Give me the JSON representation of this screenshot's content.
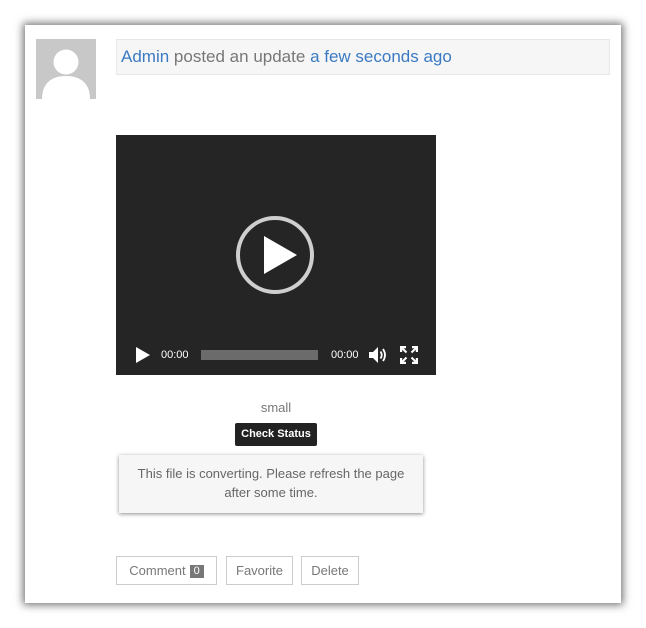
{
  "activity": {
    "user_name": "Admin",
    "action_text": "posted an update",
    "time_text": "a few seconds ago"
  },
  "video": {
    "current_time": "00:00",
    "duration": "00:00",
    "progress": 0
  },
  "media": {
    "caption": "small",
    "check_status_label": "Check Status",
    "notice_text": "This file is converting. Please refresh the page after some time."
  },
  "actions": {
    "comment_label": "Comment",
    "comment_count": "0",
    "favorite_label": "Favorite",
    "delete_label": "Delete"
  },
  "colors": {
    "link": "#3b7ac2",
    "muted_text": "#777777",
    "video_bg": "#252525",
    "button_dark": "#222222"
  },
  "icons": {
    "avatar": "default-user-avatar-icon",
    "big_play": "play-circle-icon",
    "play": "play-icon",
    "volume": "volume-icon",
    "fullscreen": "fullscreen-icon"
  }
}
